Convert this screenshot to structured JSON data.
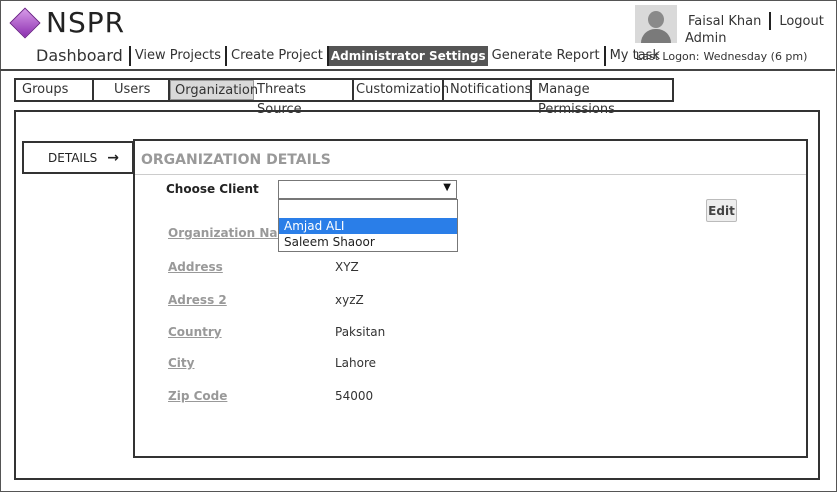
{
  "app": {
    "logo_text": "NSPR"
  },
  "user": {
    "name": "Faisal Khan",
    "logout_label": "Logout",
    "role": "Admin",
    "last_logon_label": "Last Logon:",
    "last_logon_value": "Wednesday (6 pm)"
  },
  "main_nav": {
    "dashboard": "Dashboard",
    "view_projects": "View Projects",
    "create_project": "Create Project",
    "admin_settings": "Administrator Settings",
    "generate_report": "Generate Report",
    "my_task": "My task"
  },
  "sub_tabs": {
    "groups": "Groups",
    "users": "Users",
    "organization": "Organization",
    "threats_source": "Threats Source",
    "customization": "Customization",
    "notifications": "Notifications",
    "manage_permissions": "Manage Permissions"
  },
  "details_tab": {
    "label": "DETAILS",
    "arrow": "→"
  },
  "panel": {
    "title": "ORGANIZATION DETAILS",
    "choose_client_label": "Choose Client",
    "select_value": "",
    "dropdown_options": [
      "Amjad ALI",
      "Saleem Shaoor"
    ],
    "edit_label": "Edit"
  },
  "fields": [
    {
      "label": "Organization Name",
      "value": ""
    },
    {
      "label": "Address",
      "value": "XYZ"
    },
    {
      "label": "Adress 2",
      "value": "xyzZ"
    },
    {
      "label": "Country",
      "value": "Paksitan"
    },
    {
      "label": "City",
      "value": "Lahore"
    },
    {
      "label": "Zip Code",
      "value": "54000"
    }
  ]
}
